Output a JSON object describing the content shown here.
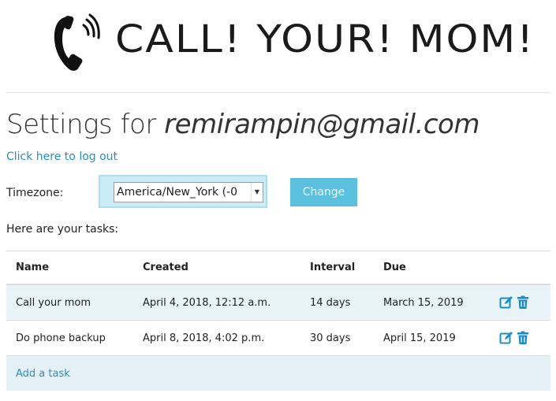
{
  "logo": {
    "text": "CALL! YOUR! MOM!",
    "icon": "phone-ringing-icon"
  },
  "header": {
    "title_prefix": "Settings for ",
    "email": "remirampin@gmail.com",
    "logout_label": "Click here to log out"
  },
  "timezone": {
    "label": "Timezone:",
    "selected": "America/New_York (-0",
    "button_label": "Change"
  },
  "tasks": {
    "intro": "Here are your tasks:",
    "columns": [
      "Name",
      "Created",
      "Interval",
      "Due"
    ],
    "rows": [
      {
        "name": "Call your mom",
        "created": "April 4, 2018, 12:12 a.m.",
        "interval": "14 days",
        "due": "March 15, 2019"
      },
      {
        "name": "Do phone backup",
        "created": "April 8, 2018, 4:02 p.m.",
        "interval": "30 days",
        "due": "April 15, 2019"
      }
    ],
    "add_label": "Add a task"
  },
  "colors": {
    "link": "#2a8fb8",
    "button": "#5bc0de",
    "row_stripe": "#e8f3f8",
    "action_icon": "#1f8cc0"
  }
}
